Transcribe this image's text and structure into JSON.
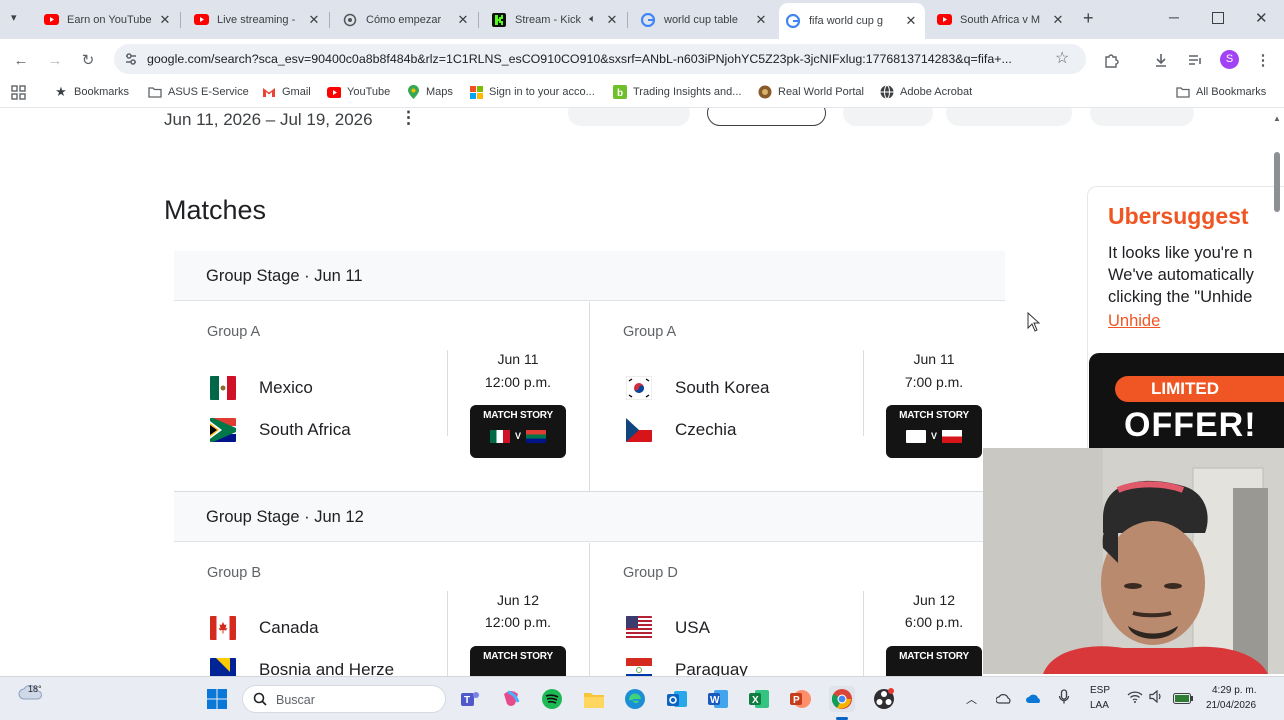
{
  "browser": {
    "tabs": [
      {
        "title": "Earn on YouTube",
        "icon": "youtube-icon",
        "active": false
      },
      {
        "title": "Live streaming -",
        "icon": "youtube-icon",
        "active": false
      },
      {
        "title": "Cómo empezar",
        "icon": "openai-icon",
        "active": false
      },
      {
        "title": "Stream - Kick",
        "icon": "kick-icon",
        "active": false
      },
      {
        "title": "world cup table",
        "icon": "google-icon",
        "active": false
      },
      {
        "title": "fifa world cup g",
        "icon": "google-icon",
        "active": true
      },
      {
        "title": "South Africa v M",
        "icon": "youtube-icon",
        "active": false
      }
    ],
    "url": "google.com/search?sca_esv=90400c0a8b8f484b&rlz=1C1RLNS_esCO910CO910&sxsrf=ANbL-n603iPNjohYC5Z23pk-3jcNIFxlug:1776813714283&q=fifa+...",
    "profile_initial": "S",
    "bookmarks": [
      {
        "label": "Bookmarks",
        "icon": "star-icon"
      },
      {
        "label": "ASUS E-Service",
        "icon": "folder-icon"
      },
      {
        "label": "Gmail",
        "icon": "gmail-icon"
      },
      {
        "label": "YouTube",
        "icon": "youtube-icon"
      },
      {
        "label": "Maps",
        "icon": "maps-icon"
      },
      {
        "label": "Sign in to your acco...",
        "icon": "microsoft-icon"
      },
      {
        "label": "Trading Insights and...",
        "icon": "bookmark-site-icon"
      },
      {
        "label": "Real World Portal",
        "icon": "bookmark-site-icon"
      },
      {
        "label": "Adobe Acrobat",
        "icon": "globe-icon"
      }
    ],
    "all_bookmarks": "All Bookmarks"
  },
  "page": {
    "date_range": "Jun 11, 2026 – Jul 19, 2026",
    "more_symbol": "⋮",
    "section_title": "Matches",
    "stages": [
      {
        "heading": "Group Stage · Jun 11",
        "matches": [
          {
            "group": "Group A",
            "team1": "Mexico",
            "team2": "South Africa",
            "date": "Jun 11",
            "time": "12:00 p.m.",
            "story": "MATCH STORY"
          },
          {
            "group": "Group A",
            "team1": "South Korea",
            "team2": "Czechia",
            "date": "Jun 11",
            "time": "7:00 p.m.",
            "story": "MATCH STORY"
          }
        ]
      },
      {
        "heading": "Group Stage · Jun 12",
        "matches": [
          {
            "group": "Group B",
            "team1": "Canada",
            "team2": "Bosnia and Herze",
            "date": "Jun 12",
            "time": "12:00 p.m.",
            "story": "MATCH STORY"
          },
          {
            "group": "Group D",
            "team1": "USA",
            "team2": "Paraguay",
            "date": "Jun 12",
            "time": "6:00 p.m.",
            "story": "MATCH STORY"
          }
        ]
      }
    ],
    "story_v": "V"
  },
  "ad": {
    "brand": "Ubersuggest",
    "lines": [
      "It looks like you're n",
      "We've automatically",
      "clicking the \"Unhide"
    ],
    "unhide": "Unhide",
    "limited": "LIMITED",
    "offer": "OFFER!"
  },
  "taskbar": {
    "weather_temp": "18°",
    "search_placeholder": "Buscar",
    "lang_top": "ESP",
    "lang_bottom": "LAA",
    "time": "4:29 p. m.",
    "date": "21/04/2026"
  },
  "colors": {
    "accent_orange": "#f05623",
    "active_tab": "#ffffff",
    "tabstrip": "#dfe3eb"
  }
}
